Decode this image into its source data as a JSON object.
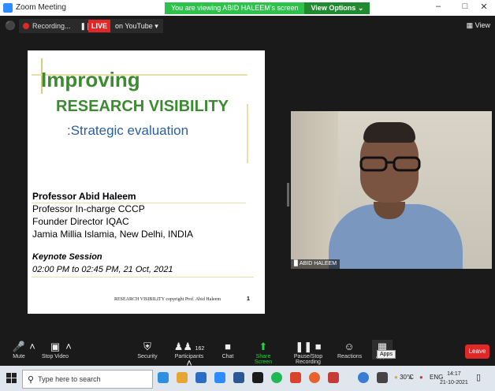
{
  "window": {
    "title": "Zoom Meeting",
    "share_banner": "You are viewing ABID HALEEM's screen",
    "view_options": "View Options ⌄",
    "controls": [
      "–",
      "□",
      "✕"
    ]
  },
  "topbar": {
    "recording_label": "Recording...",
    "pause": "❚❚",
    "stop": "■",
    "live_tag": "LIVE",
    "live_target": "on YouTube ▾",
    "view_label": "View"
  },
  "slide": {
    "title1": "Improving",
    "title2": "RESEARCH VISIBILITY",
    "title3": ":Strategic evaluation",
    "presenter": "Professor Abid Haleem",
    "line1": "Professor In-charge CCCP",
    "line2": "Founder Director IQAC",
    "line3": "Jamia Millia Islamia, New Delhi, INDIA",
    "keynote": "Keynote Session",
    "time": "02:00 PM to 02:45 PM, 21 Oct, 2021",
    "footer": "RESEARCH VISIBILITY copyright Prof. Abid Haleem",
    "page_number": "1"
  },
  "video": {
    "participant_name": "ABID HALEEM"
  },
  "toolbar": {
    "mute": "Mute",
    "stop_video": "Stop Video",
    "security": "Security",
    "participants": "Participants",
    "participants_count": "162",
    "chat": "Chat",
    "share_screen": "Share Screen",
    "pause_recording": "Pause/Stop Recording",
    "reactions": "Reactions",
    "apps": "Apps",
    "leave": "Leave"
  },
  "taskbar": {
    "search_placeholder": "Type here to search",
    "weather": "30°C",
    "language": "ENG",
    "time": "14:17",
    "date": "21-10-2021"
  },
  "colors": {
    "title_green": "#3d8a33",
    "subtitle_blue": "#2a5fa0",
    "banner_green": "#2ec24d",
    "live_red": "#e02828",
    "leave_red": "#e02828"
  }
}
